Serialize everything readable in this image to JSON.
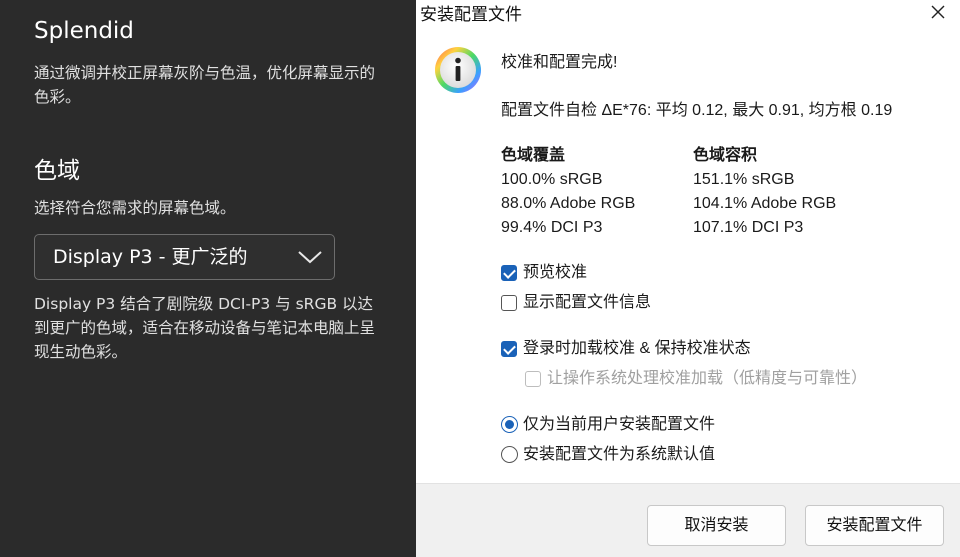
{
  "left_panel": {
    "title": "Splendid",
    "description": "通过微调并校正屏幕灰阶与色温，优化屏幕显示的色彩。",
    "gamut_heading": "色域",
    "gamut_sub": "选择符合您需求的屏幕色域。",
    "gamut_select_value": "Display P3 - 更广泛的",
    "gamut_explanation": "Display P3 结合了剧院级 DCI-P3 与 sRGB 以达到更广的色域，适合在移动设备与笔记本电脑上呈现生动色彩。"
  },
  "dialog": {
    "title": "安装配置文件",
    "heading": "校准和配置完成!",
    "summary": "配置文件自检 ΔE*76: 平均 0.12, 最大 0.91, 均方根 0.19",
    "coverage": {
      "header": "色域覆盖",
      "rows": [
        "100.0% sRGB",
        "88.0% Adobe RGB",
        "99.4% DCI P3"
      ]
    },
    "volume": {
      "header": "色域容积",
      "rows": [
        "151.1% sRGB",
        "104.1% Adobe RGB",
        "107.1% DCI P3"
      ]
    },
    "options": {
      "preview_label": "预览校准",
      "preview_checked": true,
      "show_info_label": "显示配置文件信息",
      "show_info_checked": false,
      "load_on_login_label": "登录时加载校准 & 保持校准状态",
      "load_on_login_checked": true,
      "os_handle_label": "让操作系统处理校准加载（低精度与可靠性）",
      "os_handle_checked": false,
      "install_user_label": "仅为当前用户安装配置文件",
      "install_system_label": "安装配置文件为系统默认值",
      "selected_scope": "current_user"
    },
    "buttons": {
      "cancel": "取消安装",
      "install": "安装配置文件"
    }
  },
  "colors": {
    "accent": "#1a62b8",
    "left_bg": "#2b2b2b",
    "footer_bg": "#f0f0f0"
  }
}
